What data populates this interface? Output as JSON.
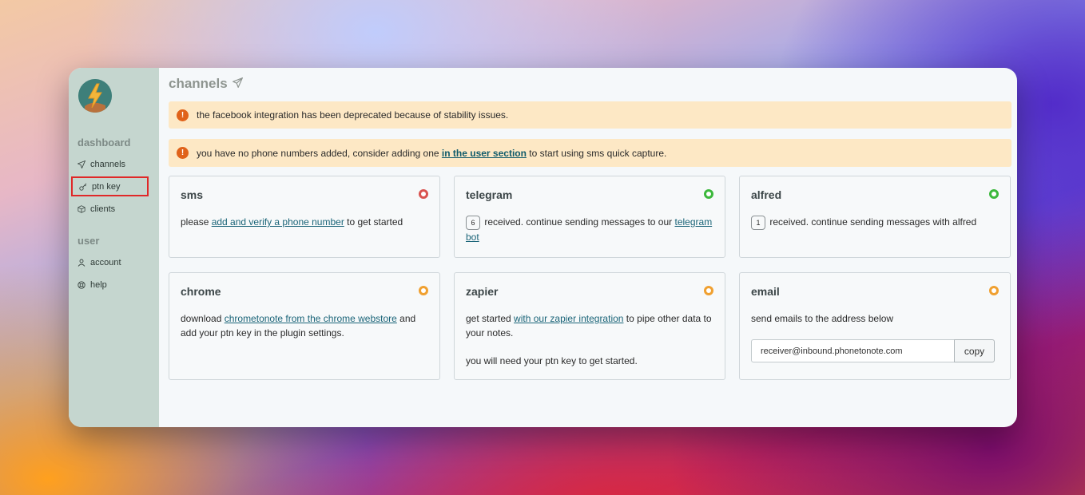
{
  "sidebar": {
    "sections": [
      {
        "heading": "dashboard",
        "items": [
          {
            "label": "channels",
            "icon": "paper-plane-icon"
          },
          {
            "label": "ptn key",
            "icon": "key-icon"
          },
          {
            "label": "clients",
            "icon": "cube-icon"
          }
        ]
      },
      {
        "heading": "user",
        "items": [
          {
            "label": "account",
            "icon": "person-icon"
          },
          {
            "label": "help",
            "icon": "lifebuoy-icon"
          }
        ]
      }
    ]
  },
  "main": {
    "title": "channels",
    "alerts": [
      {
        "text": "the facebook integration has been deprecated because of stability issues."
      },
      {
        "text_before": "you have no phone numbers added, consider adding one ",
        "link": "in the user section",
        "text_after": " to start using sms quick capture."
      }
    ],
    "cards": {
      "sms": {
        "title": "sms",
        "status": "red",
        "text_before": "please ",
        "link": "add and verify a phone number",
        "text_after": " to get started"
      },
      "telegram": {
        "title": "telegram",
        "status": "green",
        "count": "6",
        "text_before": "received. continue sending messages to our ",
        "link": "telegram bot"
      },
      "alfred": {
        "title": "alfred",
        "status": "green",
        "count": "1",
        "text": "received. continue sending messages with alfred"
      },
      "chrome": {
        "title": "chrome",
        "status": "orange",
        "text_before": "download ",
        "link": "chrometonote from the chrome webstore",
        "text_after": " and add your ptn key in the plugin settings."
      },
      "zapier": {
        "title": "zapier",
        "status": "orange",
        "text_before": "get started ",
        "link": "with our zapier integration",
        "text_after": " to pipe other data to your notes.",
        "text2": "you will need your ptn key to get started."
      },
      "email": {
        "title": "email",
        "status": "orange",
        "text": "send emails to the address below",
        "address": "receiver@inbound.phonetonote.com",
        "copy_label": "copy"
      }
    }
  },
  "colors": {
    "sidebar_bg": "#c5d6cf",
    "alert_bg": "#fde8c5",
    "link": "#1a6478",
    "status_red": "#d9534f",
    "status_green": "#3cb83c",
    "status_orange": "#f0a030"
  }
}
